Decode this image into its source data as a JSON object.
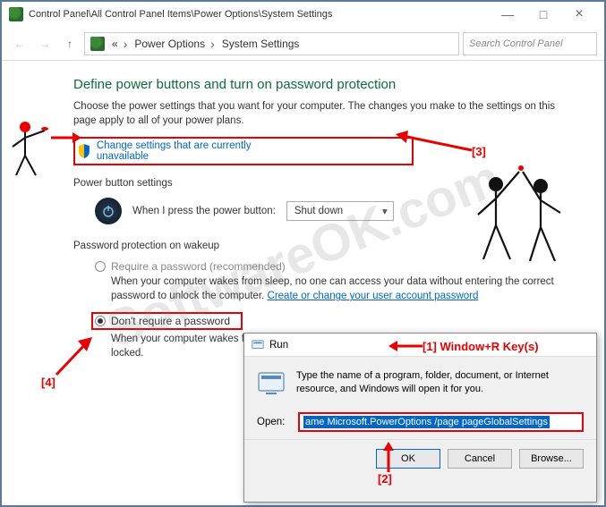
{
  "titlebar": {
    "path": "Control Panel\\All Control Panel Items\\Power Options\\System Settings"
  },
  "breadcrumb": {
    "items": [
      "Power Options",
      "System Settings"
    ]
  },
  "search": {
    "placeholder": "Search Control Panel"
  },
  "page": {
    "heading": "Define power buttons and turn on password protection",
    "description": "Choose the power settings that you want for your computer. The changes you make to the settings on this page apply to all of your power plans.",
    "change_link": "Change settings that are currently unavailable",
    "power_section": "Power button settings",
    "power_label": "When I press the power button:",
    "power_value": "Shut down",
    "password_section": "Password protection on wakeup",
    "radio_require": "Require a password (recommended)",
    "require_desc_a": "When your computer wakes from sleep, no one can access your data without entering the correct password to unlock the computer. ",
    "require_link": "Create or change your user account password",
    "radio_dont": "Don't require a password",
    "dont_desc": "When your computer wakes from sleep, anyone can access your data because the computer isn't locked."
  },
  "run": {
    "title": "Run",
    "description": "Type the name of a program, folder, document, or Internet resource, and Windows will open it for you.",
    "open_label": "Open:",
    "input_value": "ame Microsoft.PowerOptions /page pageGlobalSettings",
    "ok": "OK",
    "cancel": "Cancel",
    "browse": "Browse..."
  },
  "annotations": {
    "a1": "[1] Window+R Key(s)",
    "a2": "[2]",
    "a3": "[3]",
    "a4": "[4]"
  },
  "watermark": "SoftwareOK.com"
}
